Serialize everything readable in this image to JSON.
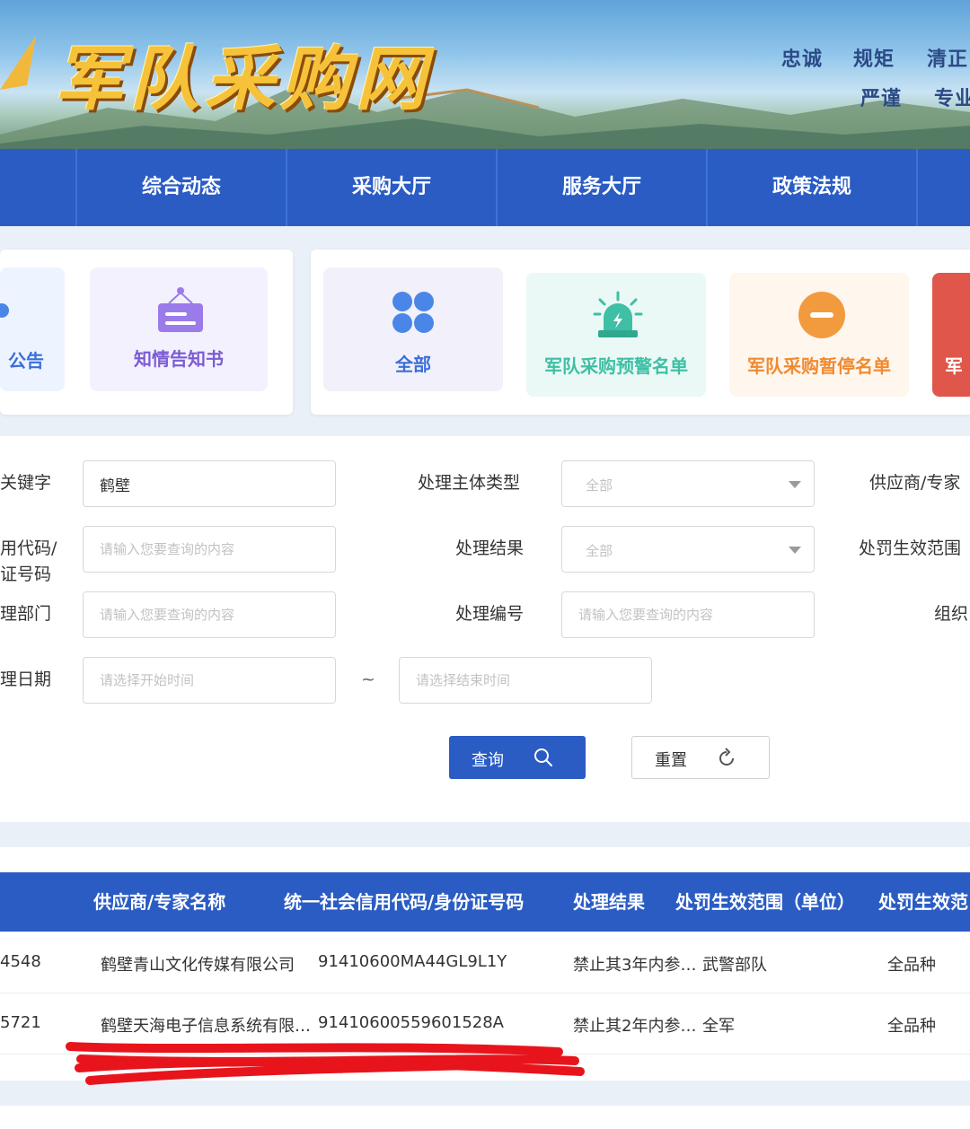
{
  "banner": {
    "site_title": "军队采购网",
    "slogans": [
      "忠诚",
      "规矩",
      "清正",
      "严谨",
      "专业"
    ]
  },
  "nav": {
    "items": [
      "综合动态",
      "采购大厅",
      "服务大厅",
      "政策法规"
    ]
  },
  "left_cards": [
    {
      "label": "公告",
      "icon": "bell-icon"
    },
    {
      "label": "知情告知书",
      "icon": "notice-board-icon"
    }
  ],
  "category_cards": [
    {
      "label": "全部",
      "icon": "grid-four-icon",
      "color": "#3b6fd8"
    },
    {
      "label": "军队采购预警名单",
      "icon": "alarm-light-icon",
      "color": "#3fbfa5"
    },
    {
      "label": "军队采购暂停名单",
      "icon": "minus-circle-icon",
      "color": "#f08a30"
    },
    {
      "label": "军",
      "icon": "",
      "color": "#e0564a"
    }
  ],
  "form": {
    "keyword": {
      "label": "关键字",
      "value": "鹤壁"
    },
    "subject_type": {
      "label": "处理主体类型",
      "value": "全部"
    },
    "supplier_label": "供应商/专家",
    "credit_code": {
      "label_line1": "用代码/",
      "label_line2": "证号码",
      "placeholder": "请输入您要查询的内容"
    },
    "result": {
      "label": "处理结果",
      "value": "全部"
    },
    "penalty_range_label": "处罚生效范围",
    "dept": {
      "label": "理部门",
      "placeholder": "请输入您要查询的内容"
    },
    "number": {
      "label": "处理编号",
      "placeholder": "请输入您要查询的内容"
    },
    "org_label": "组织",
    "date": {
      "label": "理日期",
      "start_placeholder": "请选择开始时间",
      "separator": "~",
      "end_placeholder": "请选择结束时间"
    },
    "query_button": "查询",
    "reset_button": "重置"
  },
  "table": {
    "headers": [
      "供应商/专家名称",
      "统一社会信用代码/身份证号码",
      "处理结果",
      "处罚生效范围（单位）",
      "处罚生效范"
    ],
    "rows": [
      {
        "id": "4548",
        "name": "鹤壁青山文化传媒有限公司",
        "code": "91410600MA44GL9L1Y",
        "result": "禁止其3年内参…",
        "unit": "武警部队",
        "scope": "全品种"
      },
      {
        "id": "5721",
        "name": "鹤壁天海电子信息系统有限…",
        "code": "91410600559601528A",
        "result": "禁止其2年内参…",
        "unit": "全军",
        "scope": "全品种"
      }
    ]
  },
  "colors": {
    "nav_bg": "#2a5cc4",
    "accent_button": "#2a5cc4",
    "annotation_red": "#e8141c"
  }
}
